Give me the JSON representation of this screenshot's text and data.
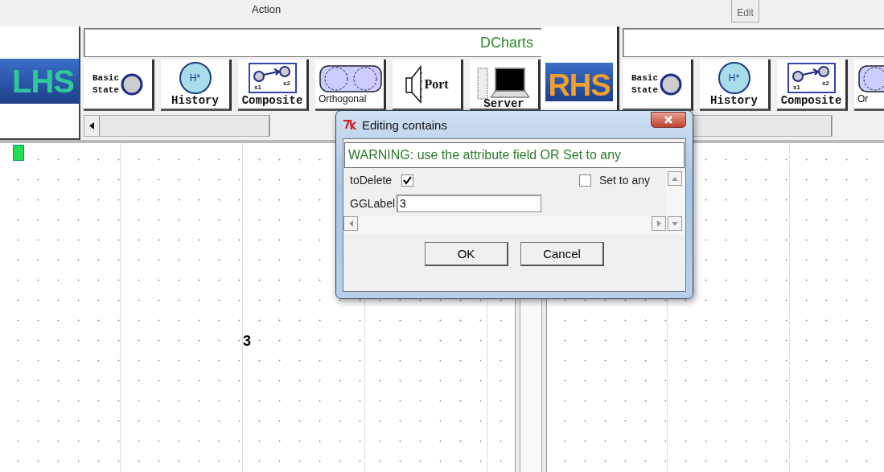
{
  "header": {
    "action_label": "Action",
    "edit_button": "Edit"
  },
  "left_panel": {
    "logo": "LHS",
    "title_field": "DCharts",
    "tools": [
      {
        "kind": "basic",
        "label": "Basic State"
      },
      {
        "kind": "history",
        "label": "History",
        "icon_text": "H*"
      },
      {
        "kind": "composite",
        "label": "Composite",
        "sub_labels": [
          "s1",
          "s2"
        ]
      },
      {
        "kind": "orthogonal",
        "label": "Orthogonal"
      },
      {
        "kind": "port",
        "label": "Port"
      },
      {
        "kind": "server",
        "label": "Server"
      }
    ]
  },
  "right_panel": {
    "logo": "RHS",
    "tools": [
      {
        "kind": "basic",
        "label": "Basic State"
      },
      {
        "kind": "history",
        "label": "History",
        "icon_text": "H*"
      },
      {
        "kind": "composite",
        "label": "Composite",
        "sub_labels": [
          "s1",
          "s2"
        ]
      },
      {
        "kind": "orthogonal",
        "label": "Or"
      }
    ]
  },
  "canvas": {
    "labels": [
      "3"
    ]
  },
  "dialog": {
    "title": "Editing contains",
    "warning": "WARNING: use the attribute field OR Set to any",
    "to_delete": {
      "label": "toDelete",
      "checked": true
    },
    "set_to_any": {
      "label": "Set to any",
      "checked": false
    },
    "gglabel": {
      "label": "GGLabel",
      "value": "3"
    },
    "buttons": [
      "OK",
      "Cancel"
    ]
  }
}
